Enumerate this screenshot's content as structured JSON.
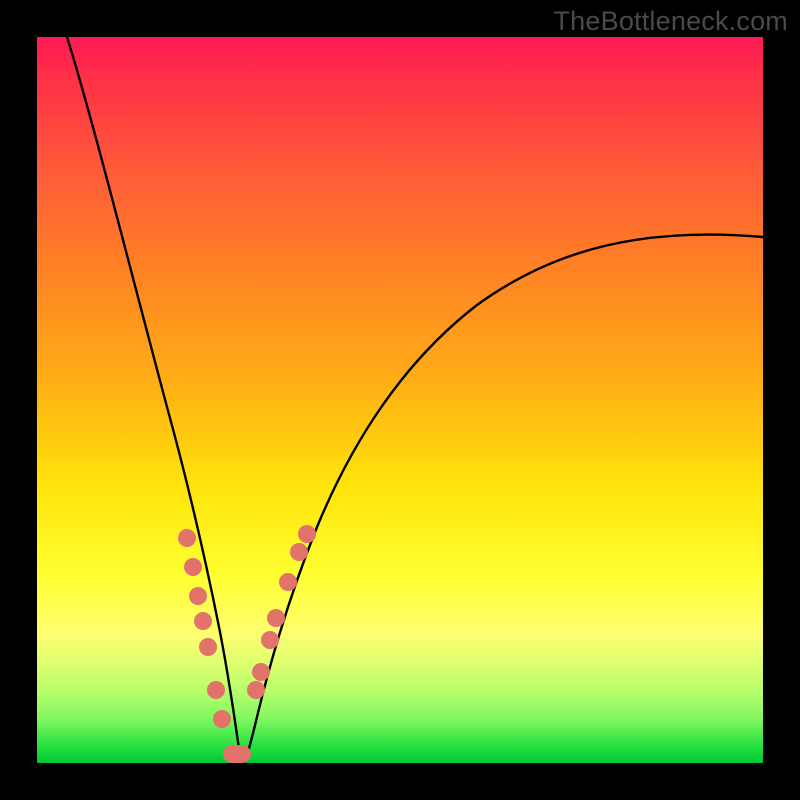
{
  "watermark": "TheBottleneck.com",
  "colors": {
    "frame": "#000000",
    "curve": "#000000",
    "dot": "#e2736b",
    "gradient_stops": [
      "#ff1a55",
      "#ff3147",
      "#ff5a3a",
      "#ff8224",
      "#ffb014",
      "#ffe40b",
      "#ffff30",
      "#ffff70",
      "#e0ff70",
      "#b8fe6a",
      "#80f760",
      "#1edf3e",
      "#00c734"
    ]
  },
  "chart_data": {
    "type": "line",
    "title": "",
    "xlabel": "",
    "ylabel": "",
    "xlim": [
      0,
      100
    ],
    "ylim": [
      0,
      100
    ],
    "grid": false,
    "legend": false,
    "note": "Two black curves forming a sharp V near x≈27. Left branch rises steeply to top; right branch rises to ≈72% height at right edge. Salmon dots cluster along lower portions of both branches near the trough.",
    "series": [
      {
        "name": "left-branch",
        "x": [
          4,
          7,
          10,
          13,
          16,
          19,
          21,
          23,
          25,
          27
        ],
        "y": [
          100,
          90,
          78,
          64,
          50,
          36,
          24,
          14,
          5,
          0
        ]
      },
      {
        "name": "right-branch",
        "x": [
          27,
          29,
          31,
          34,
          38,
          44,
          52,
          62,
          74,
          88,
          100
        ],
        "y": [
          0,
          7,
          14,
          23,
          32,
          41,
          49,
          56,
          62,
          67,
          72
        ]
      }
    ],
    "dots_left_branch": [
      {
        "x": 20.6,
        "y": 31.0
      },
      {
        "x": 21.4,
        "y": 27.0
      },
      {
        "x": 22.1,
        "y": 23.0
      },
      {
        "x": 22.7,
        "y": 19.5
      },
      {
        "x": 23.4,
        "y": 16.0
      },
      {
        "x": 24.5,
        "y": 10.0
      },
      {
        "x": 25.3,
        "y": 6.0
      }
    ],
    "dots_right_branch": [
      {
        "x": 30.0,
        "y": 10.0
      },
      {
        "x": 30.7,
        "y": 12.5
      },
      {
        "x": 32.0,
        "y": 17.0
      },
      {
        "x": 32.8,
        "y": 20.0
      },
      {
        "x": 34.5,
        "y": 25.0
      },
      {
        "x": 36.0,
        "y": 29.0
      },
      {
        "x": 37.0,
        "y": 31.5
      }
    ],
    "trough_blob": {
      "x_start": 25.5,
      "x_end": 29.5,
      "y": 1.5
    }
  }
}
